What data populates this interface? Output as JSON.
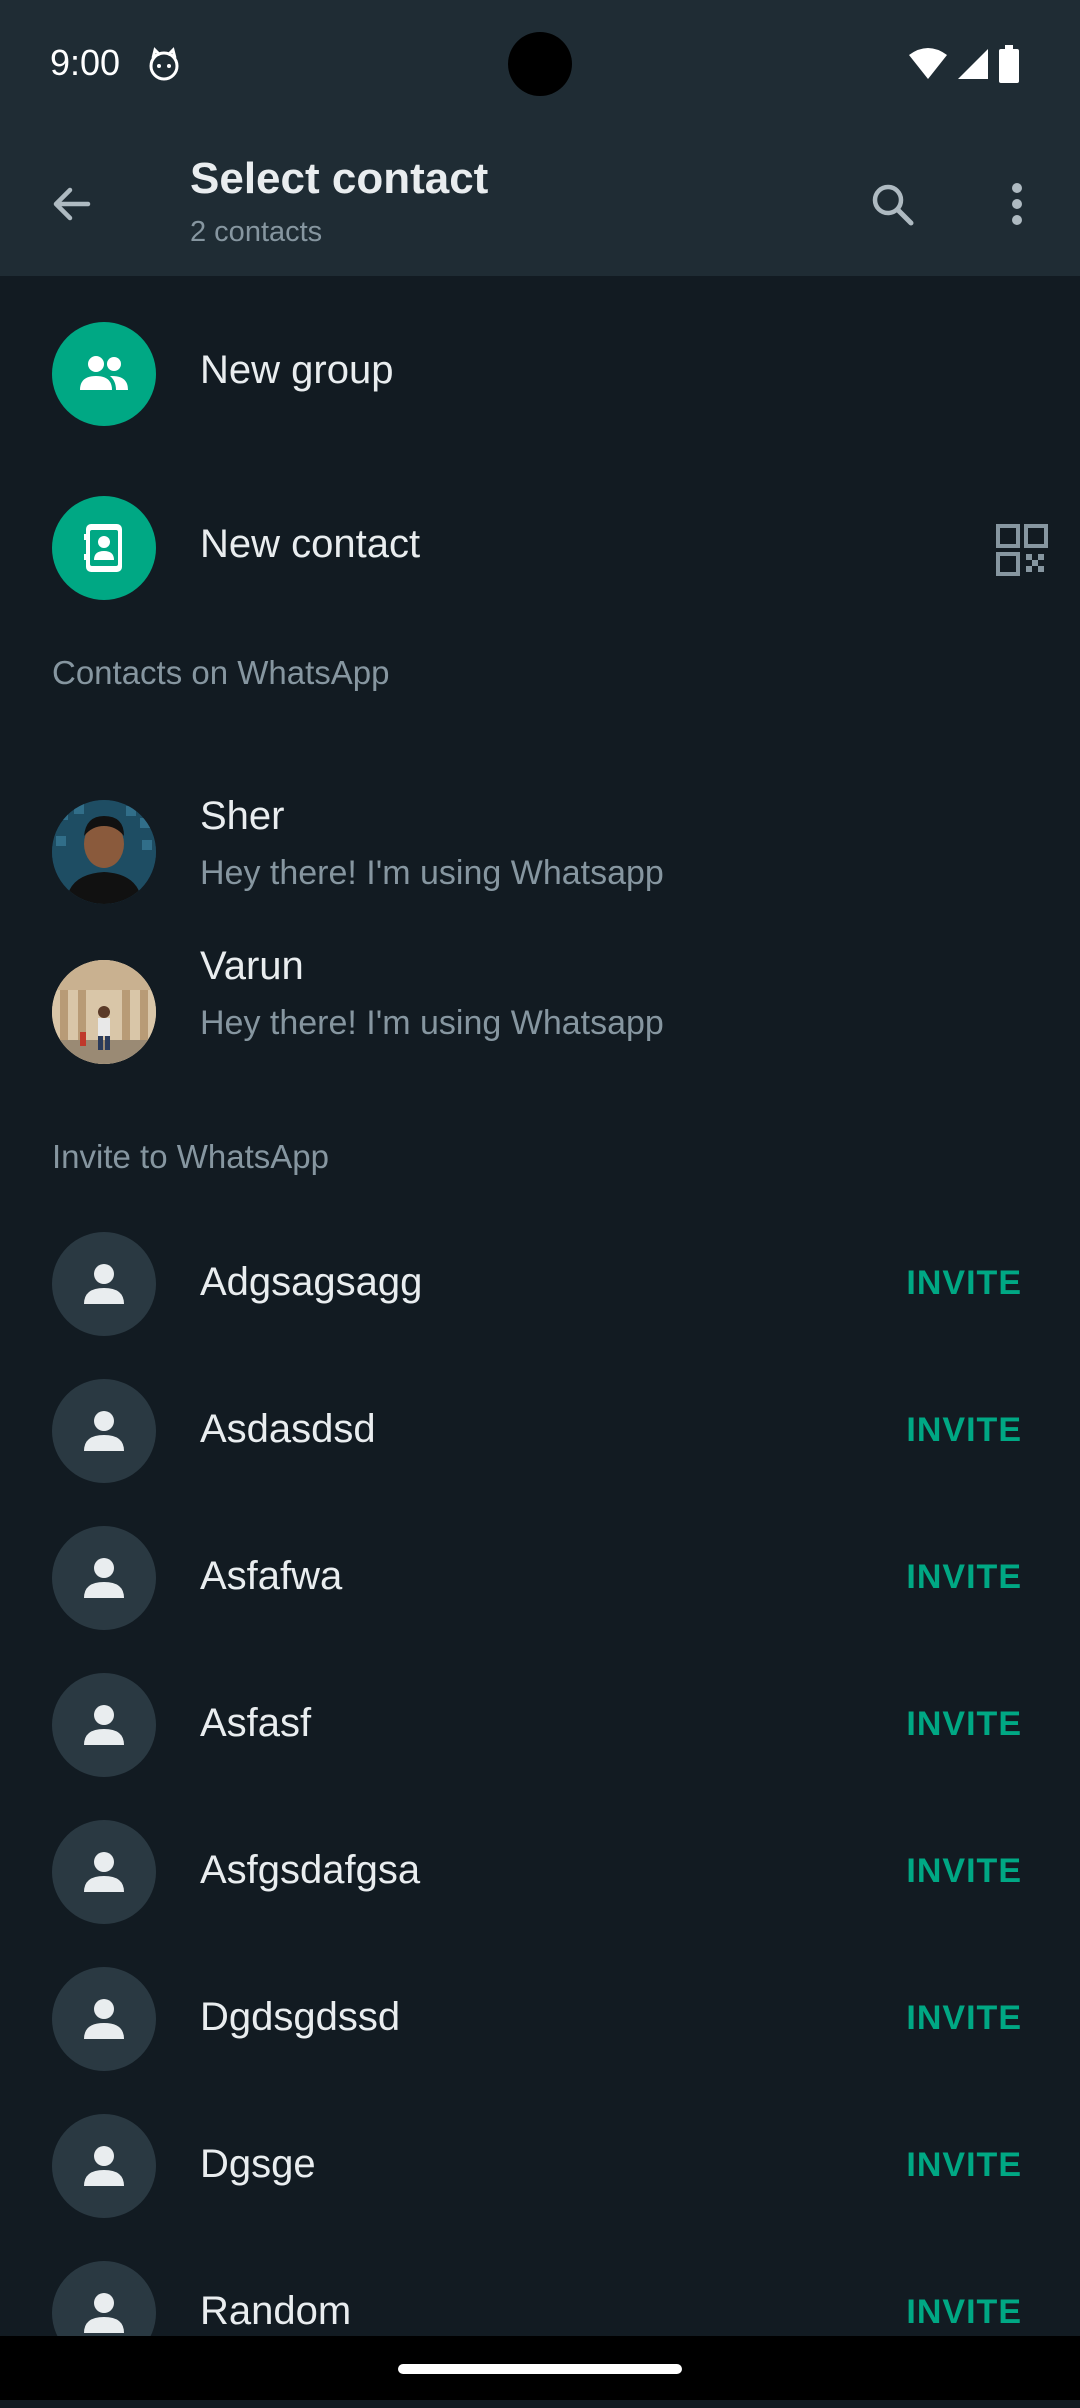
{
  "status": {
    "time": "9:00"
  },
  "header": {
    "title": "Select contact",
    "subtitle": "2 contacts"
  },
  "actions": {
    "new_group": "New group",
    "new_contact": "New contact"
  },
  "sections": {
    "on_whatsapp": "Contacts on WhatsApp",
    "invite": "Invite to WhatsApp"
  },
  "contacts": [
    {
      "name": "Sher",
      "status": "Hey there! I'm using Whatsapp"
    },
    {
      "name": "Varun",
      "status": "Hey there! I'm using Whatsapp"
    }
  ],
  "invite_label": "INVITE",
  "invite_contacts": [
    "Adgsagsagg",
    "Asdasdsd",
    "Asfafwa",
    "Asfasf",
    "Asfgsdafgsa",
    "Dgdsgdssd",
    "Dgsge",
    "Random"
  ],
  "colors": {
    "accent": "#00a884",
    "background": "#121b22",
    "appbar": "#1f2c34",
    "secondary_text": "#8696a0"
  },
  "icons": [
    "back-arrow-icon",
    "search-icon",
    "more-vert-icon",
    "group-icon",
    "contact-card-icon",
    "qr-code-icon",
    "person-icon",
    "wifi-icon",
    "signal-icon",
    "battery-icon"
  ]
}
